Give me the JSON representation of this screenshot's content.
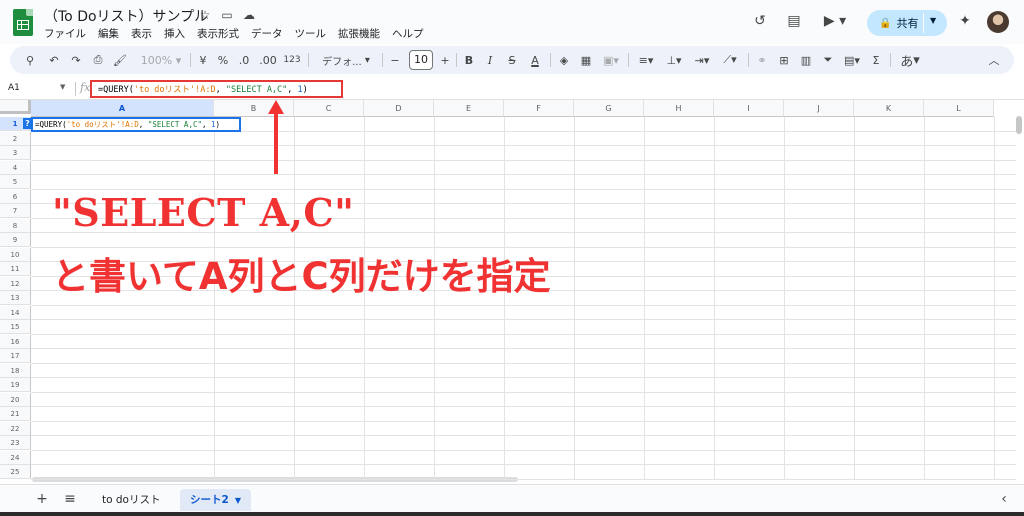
{
  "window": {
    "title": "（To Doリスト）サンプル"
  },
  "menu": [
    "ファイル",
    "編集",
    "表示",
    "挿入",
    "表示形式",
    "データ",
    "ツール",
    "拡張機能",
    "ヘルプ"
  ],
  "header_right": {
    "share_label": "共有"
  },
  "toolbar": {
    "zoom": "100%",
    "currency": "¥",
    "percent": "%",
    "dec_decrease": ".0",
    "dec_increase": ".00",
    "number_format": "123",
    "font": "デフォ...",
    "font_size": "10",
    "bold": "B",
    "italic": "I",
    "text_color": "A",
    "input_tools": "あ"
  },
  "formula_bar": {
    "cell_ref": "A1",
    "fx": "fx",
    "tokens": [
      {
        "t": "=QUERY(",
        "k": "plain"
      },
      {
        "t": "'to doリスト'!A:D",
        "k": "rng"
      },
      {
        "t": ", ",
        "k": "plain"
      },
      {
        "t": "\"SELECT A,C\"",
        "k": "str"
      },
      {
        "t": ", ",
        "k": "plain"
      },
      {
        "t": "1",
        "k": "num"
      },
      {
        "t": ")",
        "k": "plain"
      }
    ]
  },
  "grid": {
    "columns": [
      "A",
      "B",
      "C",
      "D",
      "E",
      "F",
      "G",
      "H",
      "I",
      "J",
      "K",
      "L"
    ],
    "rows": [
      "1",
      "2",
      "3",
      "4",
      "5",
      "6",
      "7",
      "8",
      "9",
      "10",
      "11",
      "12",
      "13",
      "14",
      "15",
      "16",
      "17",
      "18",
      "19",
      "20",
      "21",
      "22",
      "23",
      "24",
      "25"
    ],
    "selected_cell": "A1",
    "help_badge": "?"
  },
  "annotation": {
    "line1": "\"SELECT  A,C\"",
    "line2": "と書いてA列とC列だけを指定"
  },
  "sheets": {
    "tabs": [
      {
        "label": "to doリスト",
        "active": false
      },
      {
        "label": "シート2",
        "active": true
      }
    ]
  },
  "colors": {
    "accent": "#1a73e8",
    "annotation": "#f03232",
    "share_bg": "#c2e7ff",
    "string_token": "#188038",
    "range_token": "#e37400",
    "number_token": "#1967d2"
  }
}
